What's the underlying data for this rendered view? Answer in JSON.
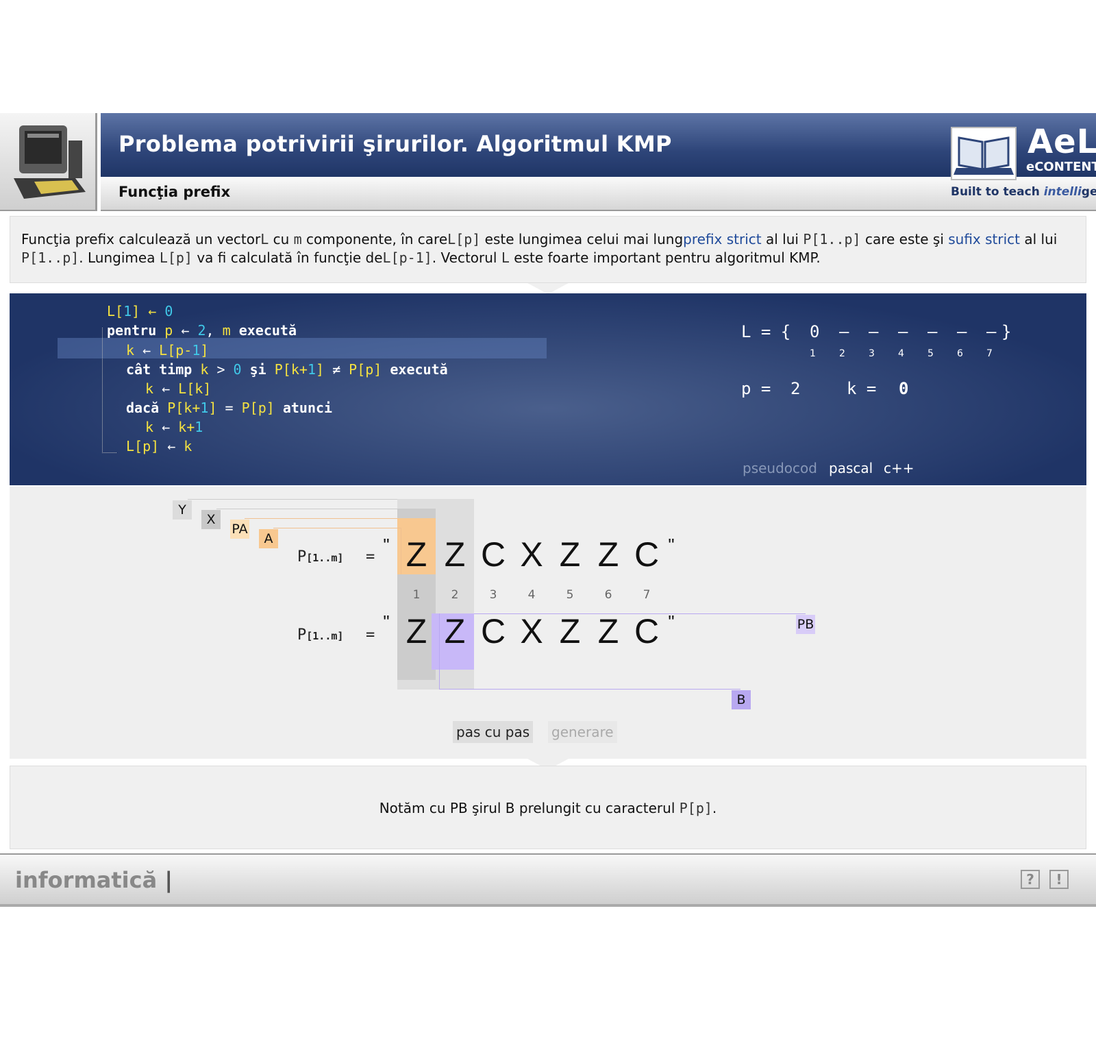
{
  "header": {
    "title": "Problema potrivirii şirurilor. Algoritmul KMP",
    "subtitle": "Funcţia prefix",
    "brand": "AeL",
    "brand_sub": "eCONTENT",
    "tagline_a": "Built to teach",
    "tagline_b": "intelli",
    "tagline_c": "gently"
  },
  "description": {
    "t1": "Funcţia prefix calculează un vector",
    "c1": "L",
    "t2": " cu ",
    "c2": "m",
    "t3": " componente, în care",
    "c3": "L[p]",
    "t4": " este lungimea celui mai lung",
    "link1": "prefix strict",
    "t5": " al lui ",
    "c4": "P[1..p]",
    "t6": " care este şi ",
    "link2": "sufix strict",
    "t7": " al lui ",
    "c5": "P[1..p]",
    "t8": ". Lungimea ",
    "c6": "L[p]",
    "t9": " va fi calculată în funcţie de",
    "c7": "L[p-1]",
    "t10": ". Vectorul ",
    "c8": "L",
    "t11": " este foarte important pentru algoritmul KMP."
  },
  "code": {
    "l1_a": "L[",
    "l1_b": "1",
    "l1_c": "] ← ",
    "l1_d": "0",
    "l2_kw": "pentru ",
    "l2_p": "p",
    "l2_arrow": " ← ",
    "l2_n": "2",
    "l2_comma": ", ",
    "l2_m": "m",
    "l2_kw2": " execută",
    "l3_k": "k",
    "l3_arrow": " ← ",
    "l3_L": "L[p-",
    "l3_1": "1",
    "l3_end": "]",
    "l4_kw": "cât timp ",
    "l4_k": "k",
    "l4_gt": " > ",
    "l4_0": "0",
    "l4_si": " şi ",
    "l4_p1": "P[k+",
    "l4_1": "1",
    "l4_p1e": "]",
    "l4_ne": " ≠ ",
    "l4_pp": "P[p]",
    "l4_kw2": " execută",
    "l5_k": "k",
    "l5_arrow": " ← ",
    "l5_L": "L[k]",
    "l6_kw": "dacă ",
    "l6_p1": "P[k+",
    "l6_1": "1",
    "l6_p1e": "]",
    "l6_eq": " = ",
    "l6_pp": "P[p]",
    "l6_kw2": " atunci",
    "l7_k": "k",
    "l7_arrow": " ← ",
    "l7_k2": "k+",
    "l7_1": "1",
    "l8_L": "L[p]",
    "l8_arrow": " ← ",
    "l8_k": "k"
  },
  "state": {
    "lvec_label": "L = {",
    "lvec_values": [
      "0",
      "–",
      "–",
      "–",
      "–",
      "–",
      "–"
    ],
    "lvec_close": "}",
    "indices": [
      "1",
      "2",
      "3",
      "4",
      "5",
      "6",
      "7"
    ],
    "p_label": "p =",
    "p_value": "2",
    "k_label": "k =",
    "k_value": "0"
  },
  "tabs": {
    "pseudocod": "pseudocod",
    "pascal": "pascal",
    "cpp": "c++"
  },
  "viz": {
    "label_y": "Y",
    "label_x": "X",
    "label_pa": "PA",
    "label_a": "A",
    "label_pb": "PB",
    "label_b": "B",
    "pexpr_main": "P",
    "pexpr_sub": "[1..m]",
    "eq": "=",
    "quote": "\"",
    "chars": [
      "Z",
      "Z",
      "C",
      "X",
      "Z",
      "Z",
      "C"
    ],
    "positions": [
      "1",
      "2",
      "3",
      "4",
      "5",
      "6",
      "7"
    ]
  },
  "buttons": {
    "step": "pas cu pas",
    "generate": "generare"
  },
  "message": {
    "t1": "Notăm cu PB şirul B prelungit cu caracterul ",
    "c1": "P[p]",
    "t2": "."
  },
  "footer": {
    "subject": "informatică",
    "sep": "|",
    "help": "?",
    "info": "!"
  },
  "colors": {
    "header_blue": "#2e4579",
    "code_bg": "#1f3466",
    "var_yellow": "#f5e240",
    "num_cyan": "#40c8e8",
    "highlight_orange": "#f8c890",
    "highlight_purple": "#c8b8f8",
    "link_blue": "#1f4a9a"
  }
}
